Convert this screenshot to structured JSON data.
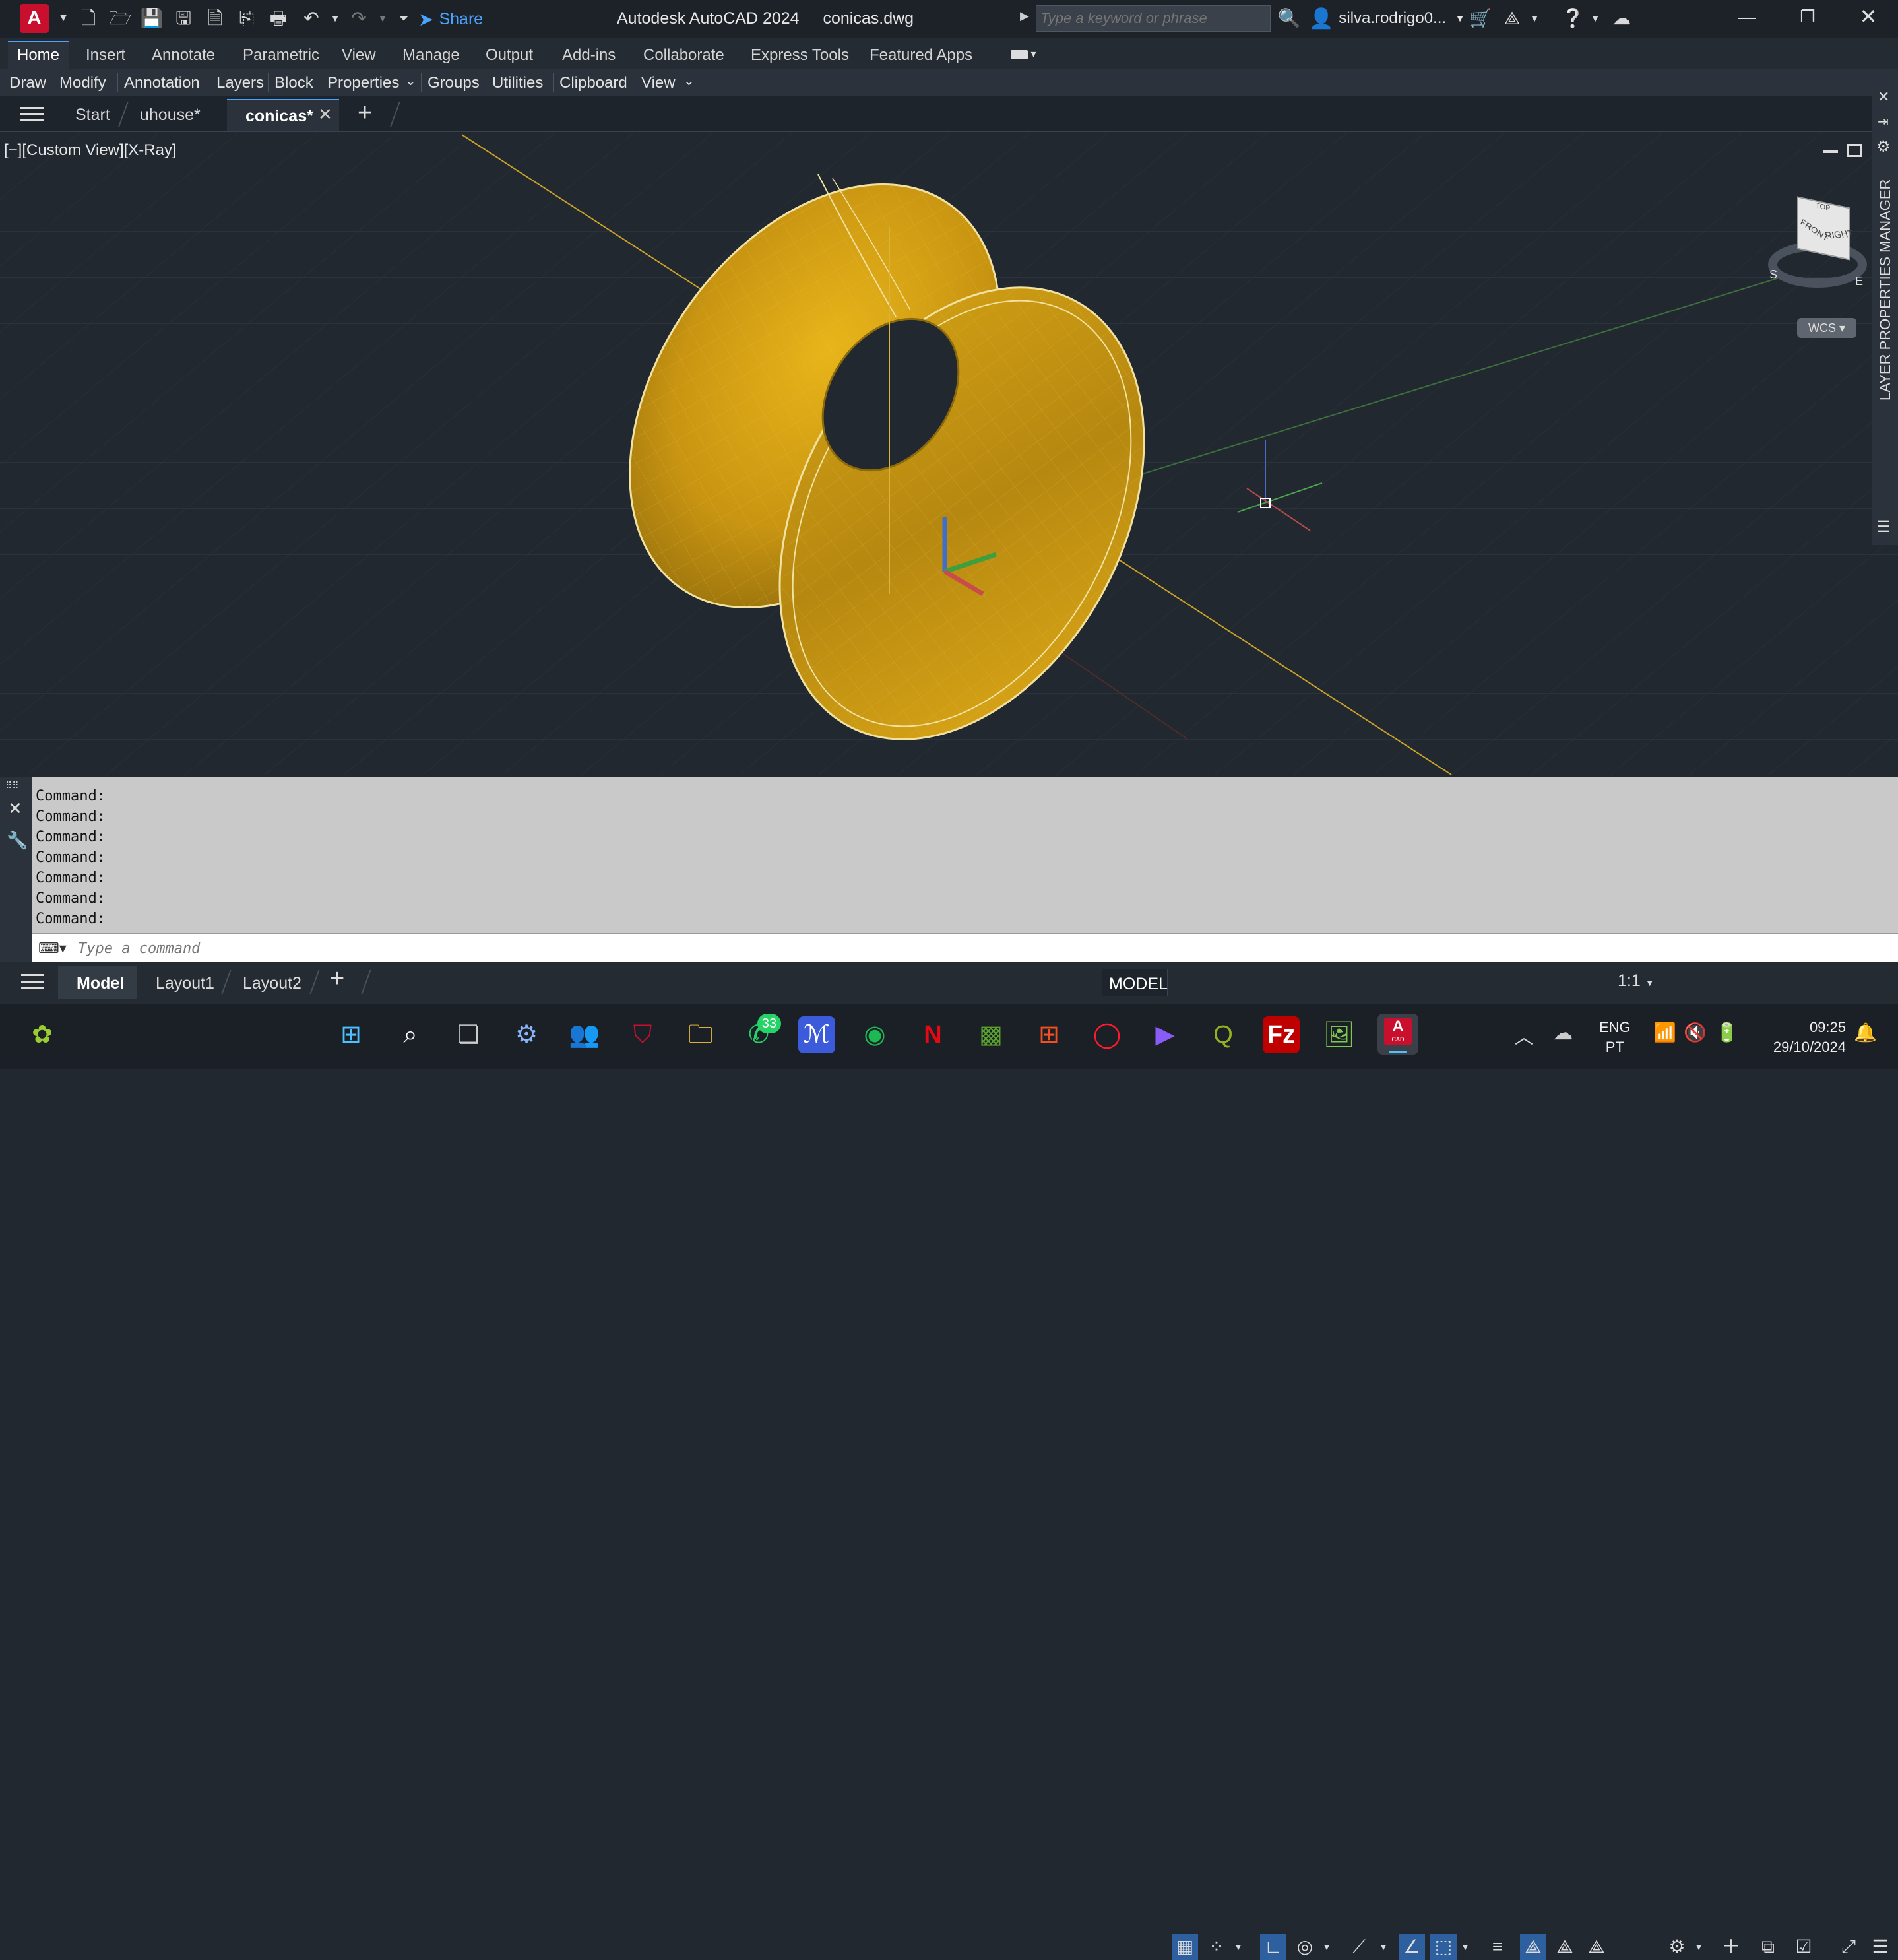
{
  "app": {
    "title": "Autodesk AutoCAD 2024",
    "filename": "conicas.dwg",
    "logo": "A"
  },
  "qat": {
    "share_label": "Share"
  },
  "search": {
    "placeholder": "Type a keyword or phrase"
  },
  "user": {
    "name": "silva.rodrigo0..."
  },
  "ribbon_tabs": [
    "Home",
    "Insert",
    "Annotate",
    "Parametric",
    "View",
    "Manage",
    "Output",
    "Add-ins",
    "Collaborate",
    "Express Tools",
    "Featured Apps"
  ],
  "panels": [
    "Draw",
    "Modify",
    "Annotation",
    "Layers",
    "Block",
    "Properties",
    "Groups",
    "Utilities",
    "Clipboard",
    "View"
  ],
  "file_tabs": [
    "Start",
    "uhouse*",
    "conicas*"
  ],
  "viewport": {
    "label": "[−][Custom View][X-Ray]",
    "viewcube_top": "TOP",
    "viewcube_front": "FRONT",
    "viewcube_right": "RIGHT",
    "compass_s": "S",
    "compass_e": "E",
    "wcs_label": "WCS",
    "side_palette": "LAYER PROPERTIES MANAGER",
    "surface_color": "#d4a012"
  },
  "command": {
    "history": [
      "Command:",
      "Command:",
      "Command:",
      "Command:",
      "Command:",
      "Command:",
      "Command:"
    ],
    "placeholder": "Type a command"
  },
  "layout_tabs": [
    "Model",
    "Layout1",
    "Layout2"
  ],
  "status": {
    "model_label": "MODEL",
    "scale_label": "1:1"
  },
  "taskbar": {
    "whatsapp_badge": "33",
    "lang": "ENG",
    "lang_region": "PT",
    "time": "09:25",
    "date": "29/10/2024",
    "autocad_icon_text": "A",
    "autocad_icon_sub": "CAD"
  }
}
